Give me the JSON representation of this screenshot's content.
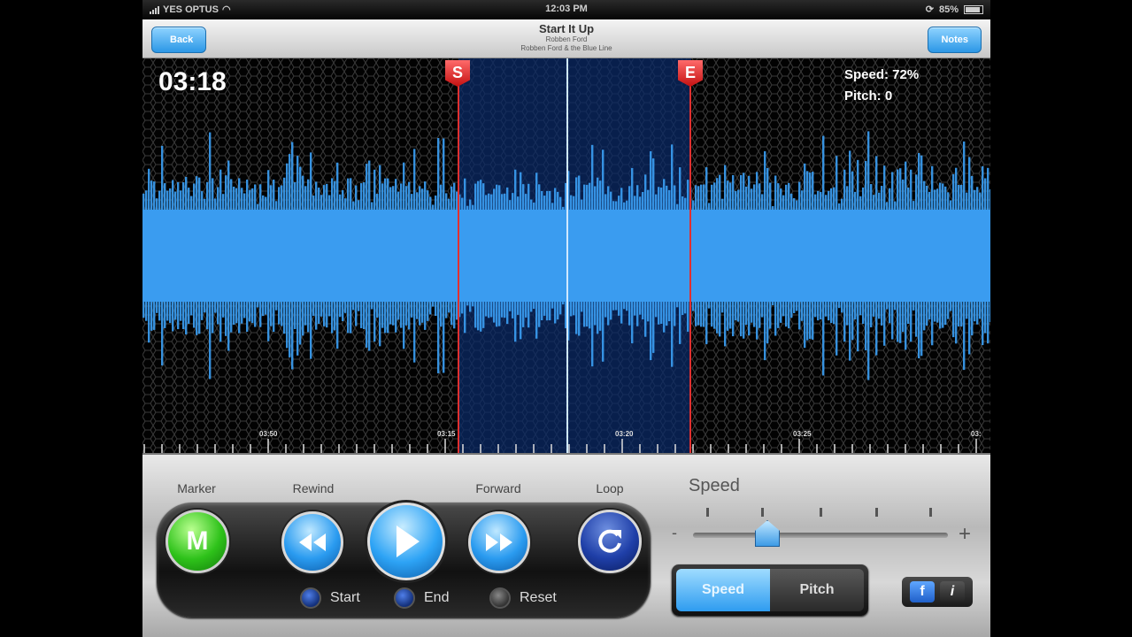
{
  "status_bar": {
    "carrier": "YES OPTUS",
    "time": "12:03 PM",
    "battery": "85%"
  },
  "nav": {
    "back_label": "Back",
    "notes_label": "Notes",
    "title": "Start It Up",
    "artist": "Robben Ford",
    "album": "Robben Ford & the Blue Line"
  },
  "waveform": {
    "current_time": "03:18",
    "speed_readout": "Speed: 72%",
    "pitch_readout": "Pitch: 0",
    "start_marker": "S",
    "end_marker": "E",
    "tick_labels": [
      "03:50",
      "03:15",
      "03:20",
      "03:25",
      "03:"
    ]
  },
  "controls": {
    "marker_label": "Marker",
    "marker_button": "M",
    "rewind_label": "Rewind",
    "forward_label": "Forward",
    "loop_label": "Loop",
    "start_label": "Start",
    "end_label": "End",
    "reset_label": "Reset"
  },
  "speed_panel": {
    "title": "Speed",
    "minus": "-",
    "plus": "+",
    "segment_speed": "Speed",
    "segment_pitch": "Pitch",
    "active_segment": "Speed"
  },
  "share": {
    "facebook": "f",
    "info": "i"
  },
  "colors": {
    "wave": "#3a9cf0",
    "selection": "#0b2a66",
    "marker": "#e03030",
    "playhead": "#cfe8ff"
  }
}
